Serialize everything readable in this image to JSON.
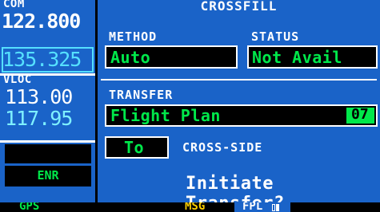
{
  "radio": {
    "com_label": "COM",
    "com_active": "122.800",
    "com_standby": "135.325",
    "vloc_label": "VLOC",
    "vloc_active": "113.00",
    "vloc_standby": "117.95",
    "mode_annunciation": "ENR"
  },
  "page": {
    "title": "CROSSFILL",
    "method_label": "METHOD",
    "method_value": "Auto",
    "status_label": "STATUS",
    "status_value": "Not Avail",
    "transfer_label": "TRANSFER",
    "transfer_value": "Flight Plan",
    "transfer_number": "07",
    "direction_value": "To",
    "direction_label": "CROSS-SIDE",
    "prompt": "Initiate Transfer?"
  },
  "status_bar": {
    "nav_source": "GPS",
    "message": "MSG",
    "page_group": "FPL"
  },
  "colors": {
    "panel_blue": "#1a63c8",
    "value_green": "#00e84a",
    "standby_cyan": "#55e0ff",
    "annunciator_yellow": "#ffd000"
  }
}
